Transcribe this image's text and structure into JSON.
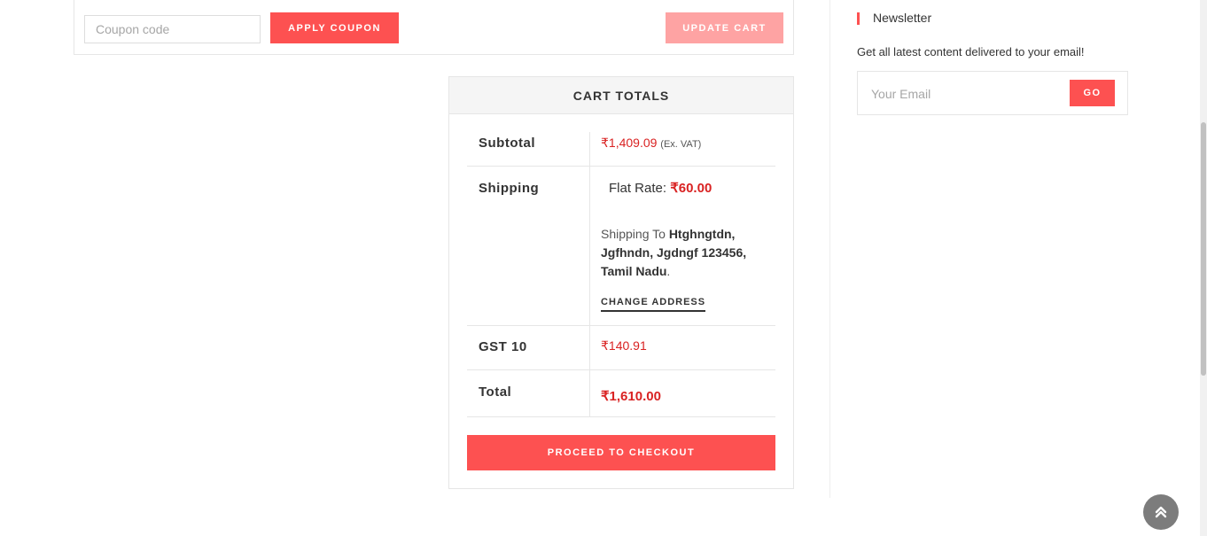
{
  "coupon": {
    "placeholder": "Coupon code",
    "apply_label": "APPLY COUPON",
    "update_label": "UPDATE CART"
  },
  "cart_totals": {
    "title": "CART TOTALS",
    "subtotal": {
      "label": "Subtotal",
      "value": "₹1,409.09",
      "note": "(Ex. VAT)"
    },
    "shipping": {
      "label": "Shipping",
      "method_label": "Flat Rate:",
      "method_value": "₹60.00",
      "to_prefix": "Shipping To",
      "address": "Htghngtdn, Jgfhndn, Jgdngf 123456, Tamil Nadu",
      "suffix": ".",
      "change_label": "CHANGE ADDRESS"
    },
    "gst": {
      "label": "GST 10",
      "value": "₹140.91"
    },
    "total": {
      "label": "Total",
      "value": "₹1,610.00"
    },
    "checkout_label": "PROCEED TO CHECKOUT"
  },
  "newsletter": {
    "title": "Newsletter",
    "description": "Get all latest content delivered to your email!",
    "placeholder": "Your Email",
    "go_label": "GO"
  },
  "icons": {
    "back_to_top": "chevrons-up-icon"
  },
  "colors": {
    "accent": "#fd5151",
    "accent_light": "#fea3a3",
    "price_red": "#d92222"
  }
}
